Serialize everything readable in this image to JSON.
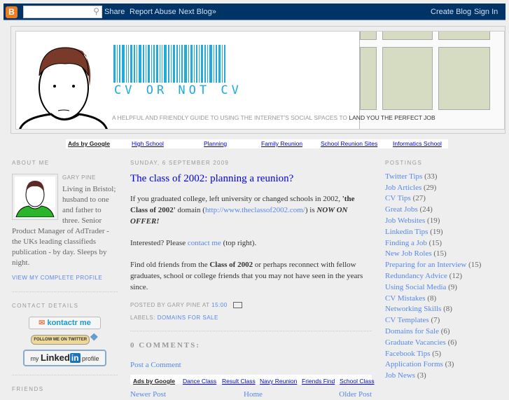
{
  "navbar": {
    "logo": "B",
    "search_placeholder": "",
    "links": [
      "Share",
      "Report Abuse",
      "Next Blog»"
    ],
    "right_links": [
      "Create Blog",
      "Sign In"
    ]
  },
  "header": {
    "title": "CV OR NOT CV",
    "tagline_a": "A HELPFUL AND FRIENDLY GUIDE TO USING THE INTERNET'S SOCIAL SPACES TO ",
    "tagline_b": "LAND YOU THE PERFECT JOB"
  },
  "top_ads": {
    "label": "Ads by Google",
    "links": [
      "High School",
      "Planning",
      "Family Reunion",
      "School Reunion Sites",
      "Informatics School"
    ]
  },
  "about": {
    "heading": "About Me",
    "name": "Gary Pine",
    "bio": "Living in Bristol; husband to one and father to three. Senior Product Manager of AdTrader - the UKs leading classifieds publication - by day. Sleeps by night.",
    "profile_link": "View my complete profile"
  },
  "contact": {
    "heading": "Contact Details",
    "kontactr": "kontactr me",
    "twitter": "FOLLOW ME ON TWITTER",
    "linkedin_a": "my",
    "linkedin_b": "Linked",
    "linkedin_c": "in",
    "linkedin_d": "profile"
  },
  "friends": {
    "heading": "Friends"
  },
  "post": {
    "date": "Sunday, 6 September 2009",
    "title": "The class of 2002: planning a reunion?",
    "p1_a": "If you graduated college, left university or changed schools in 2002, ",
    "p1_b": "'the Class of 2002'",
    "p1_c": " domain (",
    "p1_link": "http://www.theclassof2002.com/",
    "p1_d": ") is ",
    "p1_e": "NOW ON OFFER!",
    "p2_a": "Interested? Please ",
    "p2_link": "contact me",
    "p2_b": " (top right).",
    "p3_a": "Find old friends from the ",
    "p3_b": "Class of 2002",
    "p3_c": " or perhaps reconnect with fellow graduates, school or college friends that you may not have seen in the years since.",
    "posted_by": "Posted by Gary Pine at ",
    "time": "15:00",
    "labels_prefix": "Labels: ",
    "label": "Domains for Sale",
    "comments": "0 comments:",
    "post_comment": "Post a Comment"
  },
  "bottom_ads": {
    "label": "Ads by Google",
    "links": [
      "Dance Class",
      "Result Class",
      "Navy Reunion",
      "Friends Find",
      "School Class"
    ]
  },
  "pager": {
    "newer": "Newer Post",
    "home": "Home",
    "older": "Older Post"
  },
  "postings": {
    "heading": "Postings",
    "items": [
      {
        "label": "Twitter Tips",
        "count": "(33)"
      },
      {
        "label": "Job Articles",
        "count": "(29)"
      },
      {
        "label": "CV Tips",
        "count": "(27)"
      },
      {
        "label": "Great Jobs",
        "count": "(24)"
      },
      {
        "label": "Job Websites",
        "count": "(19)"
      },
      {
        "label": "Linkedin Tips",
        "count": "(19)"
      },
      {
        "label": "Finding a Job",
        "count": "(15)"
      },
      {
        "label": "New Job Roles",
        "count": "(15)"
      },
      {
        "label": "Preparing for an Interview",
        "count": "(15)"
      },
      {
        "label": "Redundancy Advice",
        "count": "(12)"
      },
      {
        "label": "Using Social Media",
        "count": "(9)"
      },
      {
        "label": "CV Mistakes",
        "count": "(8)"
      },
      {
        "label": "Networking Skills",
        "count": "(8)"
      },
      {
        "label": "CV Templates",
        "count": "(7)"
      },
      {
        "label": "Domains for Sale",
        "count": "(6)"
      },
      {
        "label": "Graduate Vacancies",
        "count": "(6)"
      },
      {
        "label": "Facebook Tips",
        "count": "(5)"
      },
      {
        "label": "Application Forms",
        "count": "(3)"
      },
      {
        "label": "Job News",
        "count": "(3)"
      }
    ]
  },
  "colors": {
    "navbar": "#003366",
    "accent": "#22aadd",
    "link": "#5588ee",
    "title": "#0000ee"
  }
}
